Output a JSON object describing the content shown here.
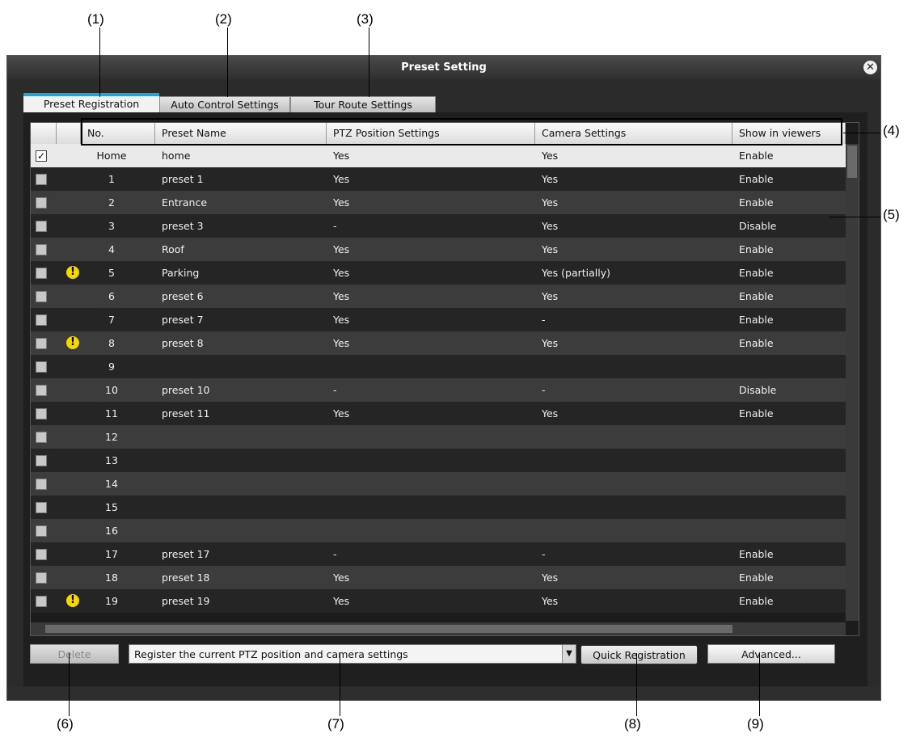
{
  "callouts": [
    "(1)",
    "(2)",
    "(3)",
    "(4)",
    "(5)",
    "(6)",
    "(7)",
    "(8)",
    "(9)"
  ],
  "window": {
    "title": "Preset Setting"
  },
  "tabs": [
    "Preset Registration",
    "Auto Control Settings",
    "Tour Route Settings"
  ],
  "columns": [
    "No.",
    "Preset Name",
    "PTZ Position Settings",
    "Camera Settings",
    "Show in viewers"
  ],
  "rows": [
    {
      "checked": true,
      "warn": false,
      "no": "Home",
      "name": "home",
      "ptz": "Yes",
      "camera": "Yes",
      "show": "Enable"
    },
    {
      "checked": false,
      "warn": false,
      "no": "1",
      "name": "preset 1",
      "ptz": "Yes",
      "camera": "Yes",
      "show": "Enable"
    },
    {
      "checked": false,
      "warn": false,
      "no": "2",
      "name": "Entrance",
      "ptz": "Yes",
      "camera": "Yes",
      "show": "Enable"
    },
    {
      "checked": false,
      "warn": false,
      "no": "3",
      "name": "preset 3",
      "ptz": "-",
      "camera": "Yes",
      "show": "Disable"
    },
    {
      "checked": false,
      "warn": false,
      "no": "4",
      "name": "Roof",
      "ptz": "Yes",
      "camera": "Yes",
      "show": "Enable"
    },
    {
      "checked": false,
      "warn": true,
      "no": "5",
      "name": "Parking",
      "ptz": "Yes",
      "camera": "Yes (partially)",
      "show": "Enable"
    },
    {
      "checked": false,
      "warn": false,
      "no": "6",
      "name": "preset 6",
      "ptz": "Yes",
      "camera": "Yes",
      "show": "Enable"
    },
    {
      "checked": false,
      "warn": false,
      "no": "7",
      "name": "preset 7",
      "ptz": "Yes",
      "camera": "-",
      "show": "Enable"
    },
    {
      "checked": false,
      "warn": true,
      "no": "8",
      "name": "preset 8",
      "ptz": "Yes",
      "camera": "Yes",
      "show": "Enable"
    },
    {
      "checked": false,
      "warn": false,
      "no": "9",
      "name": "",
      "ptz": "",
      "camera": "",
      "show": ""
    },
    {
      "checked": false,
      "warn": false,
      "no": "10",
      "name": "preset 10",
      "ptz": "-",
      "camera": "-",
      "show": "Disable"
    },
    {
      "checked": false,
      "warn": false,
      "no": "11",
      "name": "preset 11",
      "ptz": "Yes",
      "camera": "Yes",
      "show": "Enable"
    },
    {
      "checked": false,
      "warn": false,
      "no": "12",
      "name": "",
      "ptz": "",
      "camera": "",
      "show": ""
    },
    {
      "checked": false,
      "warn": false,
      "no": "13",
      "name": "",
      "ptz": "",
      "camera": "",
      "show": ""
    },
    {
      "checked": false,
      "warn": false,
      "no": "14",
      "name": "",
      "ptz": "",
      "camera": "",
      "show": ""
    },
    {
      "checked": false,
      "warn": false,
      "no": "15",
      "name": "",
      "ptz": "",
      "camera": "",
      "show": ""
    },
    {
      "checked": false,
      "warn": false,
      "no": "16",
      "name": "",
      "ptz": "",
      "camera": "",
      "show": ""
    },
    {
      "checked": false,
      "warn": false,
      "no": "17",
      "name": "preset 17",
      "ptz": "-",
      "camera": "-",
      "show": "Enable"
    },
    {
      "checked": false,
      "warn": false,
      "no": "18",
      "name": "preset 18",
      "ptz": "Yes",
      "camera": "Yes",
      "show": "Enable"
    },
    {
      "checked": false,
      "warn": true,
      "no": "19",
      "name": "preset 19",
      "ptz": "Yes",
      "camera": "Yes",
      "show": "Enable"
    }
  ],
  "buttons": {
    "delete": "Delete",
    "register_select": "Register the current PTZ position and camera settings",
    "quick_registration": "Quick Registration",
    "advanced": "Advanced..."
  },
  "icons": {
    "close": "close-icon",
    "warning": "warning-icon",
    "checkbox": "checkbox-icon"
  },
  "colors": {
    "active_tab_accent": "#2aa3c8",
    "warning": "#f5d800",
    "selected_row": "#eaeaea"
  }
}
